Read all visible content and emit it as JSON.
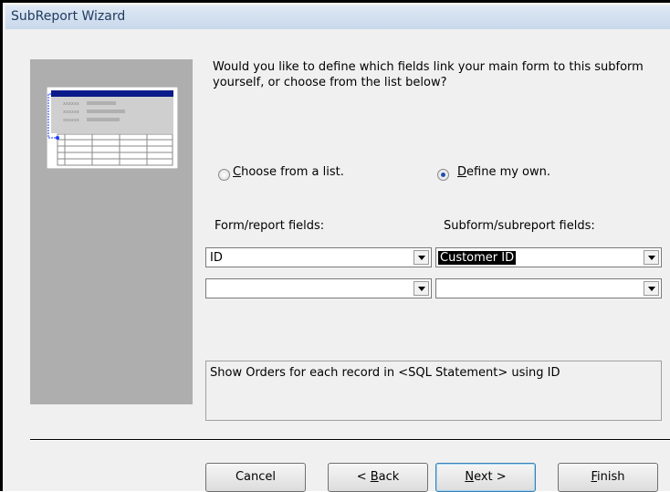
{
  "window": {
    "title": "SubReport Wizard"
  },
  "question": "Would you like to define which fields link your main form to this subform yourself, or choose from the list below?",
  "options": {
    "choose_from_list": {
      "pre": "",
      "key": "C",
      "post": "hoose from a list.",
      "selected": false
    },
    "define_my_own": {
      "pre": "",
      "key": "D",
      "post": "efine my own.",
      "selected": true
    }
  },
  "fields": {
    "form_label": "Form/report fields:",
    "subform_label": "Subform/subreport fields:",
    "form_values": [
      "ID",
      ""
    ],
    "subform_values": [
      "Customer ID",
      ""
    ]
  },
  "summary": "Show Orders for each record in <SQL Statement> using ID",
  "buttons": {
    "cancel": "Cancel",
    "back": {
      "pre": "< ",
      "key": "B",
      "post": "ack"
    },
    "next": {
      "pre": "",
      "key": "N",
      "post": "ext >"
    },
    "finish": {
      "pre": "",
      "key": "F",
      "post": "inish"
    }
  },
  "illustration": {
    "placeholder": "xxxxxx"
  }
}
